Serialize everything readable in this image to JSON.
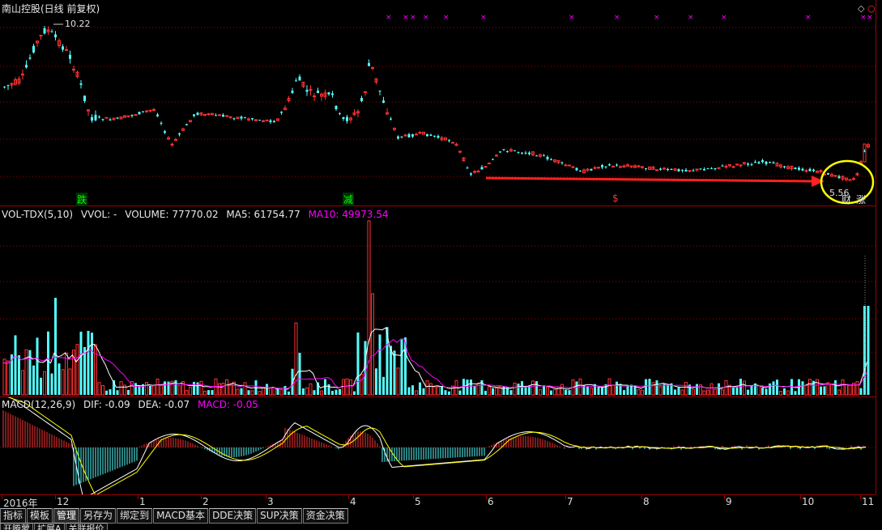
{
  "price_panel": {
    "title": "南山控股(日线 前复权)",
    "high_label": "10.22",
    "low_label": "5.56",
    "signals": [
      "跌",
      "减",
      "$"
    ],
    "recent_marks": [
      "财",
      "涨"
    ]
  },
  "volume_panel": {
    "indicator": "VOL-TDX(5,10)",
    "vvol": "VVOL: -",
    "volume": "VOLUME: 77770.02",
    "ma5": "MA5: 61754.77",
    "ma10": "MA10: 49973.54"
  },
  "macd_panel": {
    "indicator": "MACD(12,26,9)",
    "dif": "DIF: -0.09",
    "dea": "DEA: -0.07",
    "macd": "MACD: -0.05"
  },
  "time_axis": {
    "labels": [
      "2016年",
      "12",
      "1",
      "2",
      "3",
      "4",
      "5",
      "6",
      "7",
      "8",
      "9",
      "10",
      "11"
    ]
  },
  "toolbar": {
    "tabs": [
      "指标",
      "模板",
      "管理",
      "另存为",
      "绑定到",
      "MACD基本",
      "DDE决策",
      "SUP决策",
      "资金决策"
    ],
    "active": "管理"
  },
  "toolbar2": {
    "tabs": [
      "开腾蒙",
      "扩展A",
      "关联报价"
    ]
  },
  "colors": {
    "up": "#ff3232",
    "down": "#54ffff",
    "ma_white": "#ffffff",
    "ma_yellow": "#ffff00",
    "ma_magenta": "#ff00ff",
    "grid": "#a00000",
    "arrow": "#ff2020",
    "circle": "#ffff00"
  }
}
